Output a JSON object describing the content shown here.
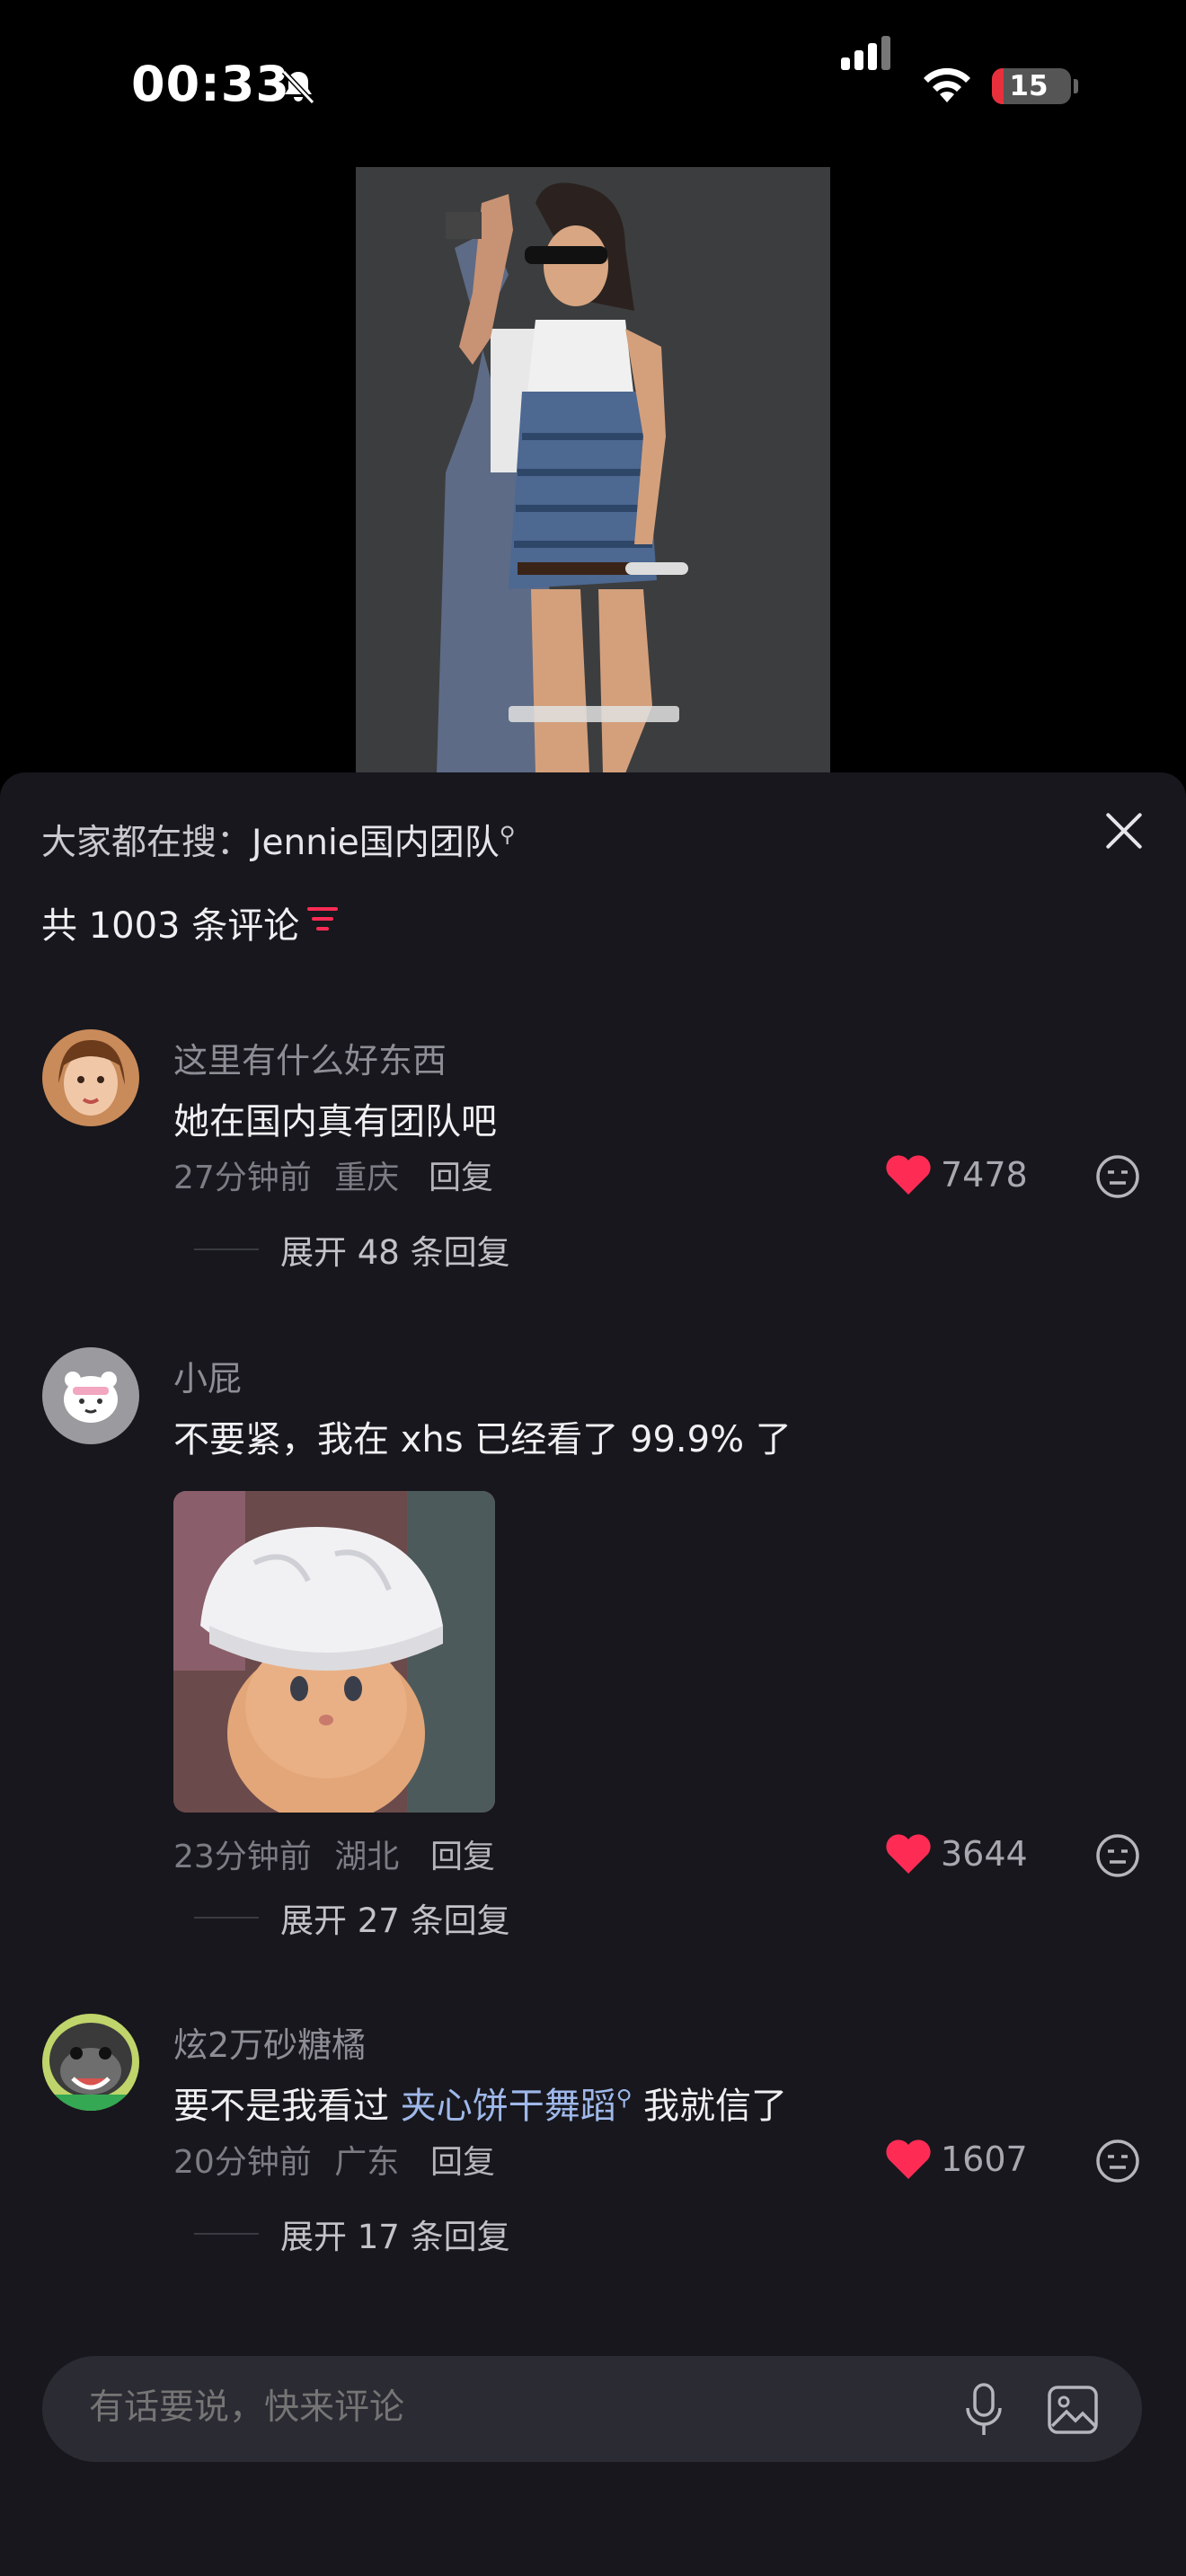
{
  "status_bar": {
    "time": "00:33",
    "battery": "15",
    "battery_level_percent": 15
  },
  "colors": {
    "accent": "#fe2c55",
    "background": "#000000",
    "sheet": "#17171d",
    "link": "#9fb8ea"
  },
  "sheet": {
    "search_prefix": "大家都在搜：",
    "search_keyword": "Jennie国内团队",
    "comment_count_label": "共 1003 条评论"
  },
  "comments": [
    {
      "username": "这里有什么好东西",
      "text": "她在国内真有团队吧",
      "time": "27分钟前",
      "location": "重庆",
      "reply_label": "回复",
      "likes": "7478",
      "expand": "展开 48 条回复"
    },
    {
      "username": "小屁",
      "text": "不要紧，我在 xhs 已经看了 99.9% 了",
      "time": "23分钟前",
      "location": "湖北",
      "reply_label": "回复",
      "likes": "3644",
      "expand": "展开 27 条回复"
    },
    {
      "username": "炫2万砂糖橘",
      "text_before": "要不是我看过 ",
      "text_link": "夹心饼干舞蹈",
      "text_after": " 我就信了",
      "time": "20分钟前",
      "location": "广东",
      "reply_label": "回复",
      "likes": "1607",
      "expand": "展开 17 条回复"
    }
  ],
  "input": {
    "placeholder": "有话要说，快来评论"
  },
  "icons": [
    "bell-muted-icon",
    "signal-icon",
    "wifi-icon",
    "battery-icon",
    "close-icon",
    "sort-icon",
    "heart-icon",
    "dislike-icon",
    "mic-icon",
    "image-icon"
  ]
}
